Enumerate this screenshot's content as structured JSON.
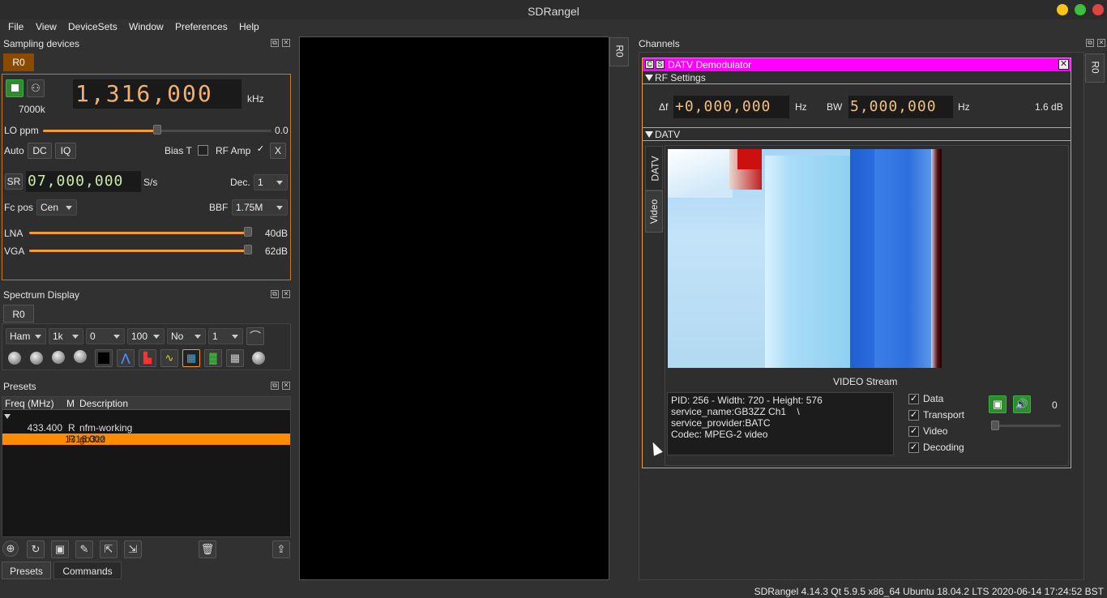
{
  "window": {
    "title": "SDRangel"
  },
  "menu": [
    "File",
    "View",
    "DeviceSets",
    "Window",
    "Preferences",
    "Help"
  ],
  "sampling": {
    "title": "Sampling devices",
    "tab": "R0",
    "rate_label": "7000k",
    "freq": "1,316,000",
    "freq_unit": "kHz",
    "lo_label": "LO ppm",
    "lo_value": "0.0",
    "lo_level": 0.5,
    "auto_label": "Auto",
    "dc_label": "DC",
    "iq_label": "IQ",
    "biast_label": "Bias T",
    "rfamp_label": "RF Amp",
    "rfamp_check": "✓",
    "x_label": "X",
    "sr_label": "SR",
    "sr_value": "07,000,000",
    "sr_unit": "S/s",
    "dec_label": "Dec.",
    "dec_value": "1",
    "fcpos_label": "Fc pos",
    "fcpos_value": "Cen",
    "bbf_label": "BBF",
    "bbf_value": "1.75M",
    "lna_label": "LNA",
    "lna_value": "40dB",
    "lna_level": 1.0,
    "vga_label": "VGA",
    "vga_value": "62dB",
    "vga_level": 1.0
  },
  "spectrum": {
    "title": "Spectrum Display",
    "tab": "R0",
    "combos": [
      "Ham",
      "1k",
      "0",
      "100",
      "No",
      "1"
    ]
  },
  "presets": {
    "title": "Presets",
    "columns": [
      "Freq (MHz)",
      "M",
      "Description"
    ],
    "rows": [
      {
        "freq": "433.400",
        "mode": "R",
        "desc": "nfm-working"
      },
      {
        "freq": "1316.000",
        "mode": "R",
        "desc": "gb3zz"
      }
    ],
    "tabs": [
      "Presets",
      "Commands"
    ]
  },
  "side_tab": "R0",
  "channels": {
    "title": "Channels",
    "side_tab": "R0",
    "demod_title": "DATV Demodulator",
    "c_label": "C",
    "s_label": "S",
    "rf_settings": "RF Settings",
    "df_label": "Δf",
    "df_value": "+0,000,000",
    "df_unit": "Hz",
    "bw_label": "BW",
    "bw_value": "5,000,000",
    "bw_unit": "Hz",
    "level": "1.6 dB",
    "datv_section": "DATV",
    "vtab_datv": "DATV",
    "vtab_video": "Video",
    "video_stream_label": "VIDEO Stream",
    "info_lines": [
      "PID: 256 - Width: 720 - Height: 576",
      "service_name:GB3ZZ Ch1    \\",
      "service_provider:BATC",
      "Codec: MPEG-2 video"
    ],
    "checks": [
      "Data",
      "Transport",
      "Video",
      "Decoding"
    ],
    "check_mark": "✓",
    "volume_value": "0"
  },
  "status_bar": "SDRangel 4.14.3 Qt 5.9.5 x86_64 Ubuntu 18.04.2 LTS  2020-06-14 17:24:52 BST",
  "colors": {
    "accent": "#f29b38",
    "highlight": "#ff8c00",
    "magenta": "#ff00ff",
    "green": "#3cb043"
  }
}
